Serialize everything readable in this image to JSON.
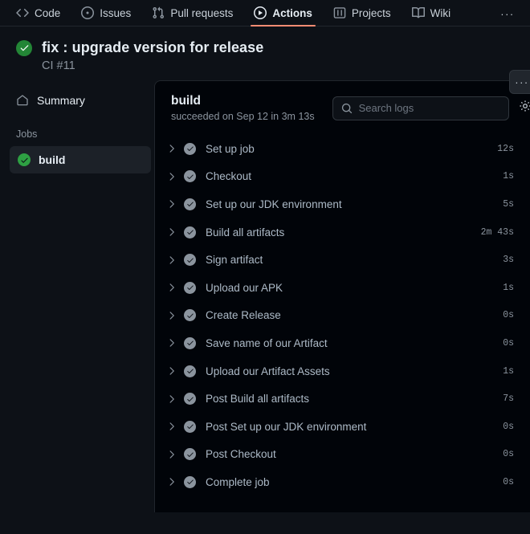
{
  "repo_nav": {
    "items": [
      {
        "label": "Code",
        "icon": "code-icon",
        "active": false
      },
      {
        "label": "Issues",
        "icon": "issue-opened-icon",
        "active": false
      },
      {
        "label": "Pull requests",
        "icon": "git-pull-request-icon",
        "active": false
      },
      {
        "label": "Actions",
        "icon": "play-circle-icon",
        "active": true
      },
      {
        "label": "Projects",
        "icon": "project-icon",
        "active": false
      },
      {
        "label": "Wiki",
        "icon": "book-icon",
        "active": false
      }
    ],
    "overflow_label": "···",
    "active_underline_color": "#fd8c73"
  },
  "run_header": {
    "status_icon": "check-circle-fill-icon",
    "status_color": "#238636",
    "title": "fix : upgrade version for release",
    "subtitle": "CI #11",
    "kebab_label": "···"
  },
  "sidebar": {
    "summary": {
      "label": "Summary",
      "icon": "home-icon"
    },
    "jobs_label": "Jobs",
    "jobs": [
      {
        "label": "build",
        "status_icon": "check-circle-fill-icon",
        "status_color": "#2ea043",
        "selected": true
      }
    ]
  },
  "log_panel": {
    "title": "build",
    "subtitle": "succeeded on Sep 12 in 3m 13s",
    "search": {
      "icon": "search-icon",
      "placeholder": "Search logs",
      "value": ""
    },
    "settings_icon": "gear-icon",
    "steps": [
      {
        "name": "Set up job",
        "duration": "12s",
        "status": "success"
      },
      {
        "name": "Checkout",
        "duration": "1s",
        "status": "success"
      },
      {
        "name": "Set up our JDK environment",
        "duration": "5s",
        "status": "success"
      },
      {
        "name": "Build all artifacts",
        "duration": "2m 43s",
        "status": "success"
      },
      {
        "name": "Sign artifact",
        "duration": "3s",
        "status": "success"
      },
      {
        "name": "Upload our APK",
        "duration": "1s",
        "status": "success"
      },
      {
        "name": "Create Release",
        "duration": "0s",
        "status": "success"
      },
      {
        "name": "Save name of our Artifact",
        "duration": "0s",
        "status": "success"
      },
      {
        "name": "Upload our Artifact Assets",
        "duration": "1s",
        "status": "success"
      },
      {
        "name": "Post Build all artifacts",
        "duration": "7s",
        "status": "success"
      },
      {
        "name": "Post Set up our JDK environment",
        "duration": "0s",
        "status": "success"
      },
      {
        "name": "Post Checkout",
        "duration": "0s",
        "status": "success"
      },
      {
        "name": "Complete job",
        "duration": "0s",
        "status": "success"
      }
    ]
  }
}
